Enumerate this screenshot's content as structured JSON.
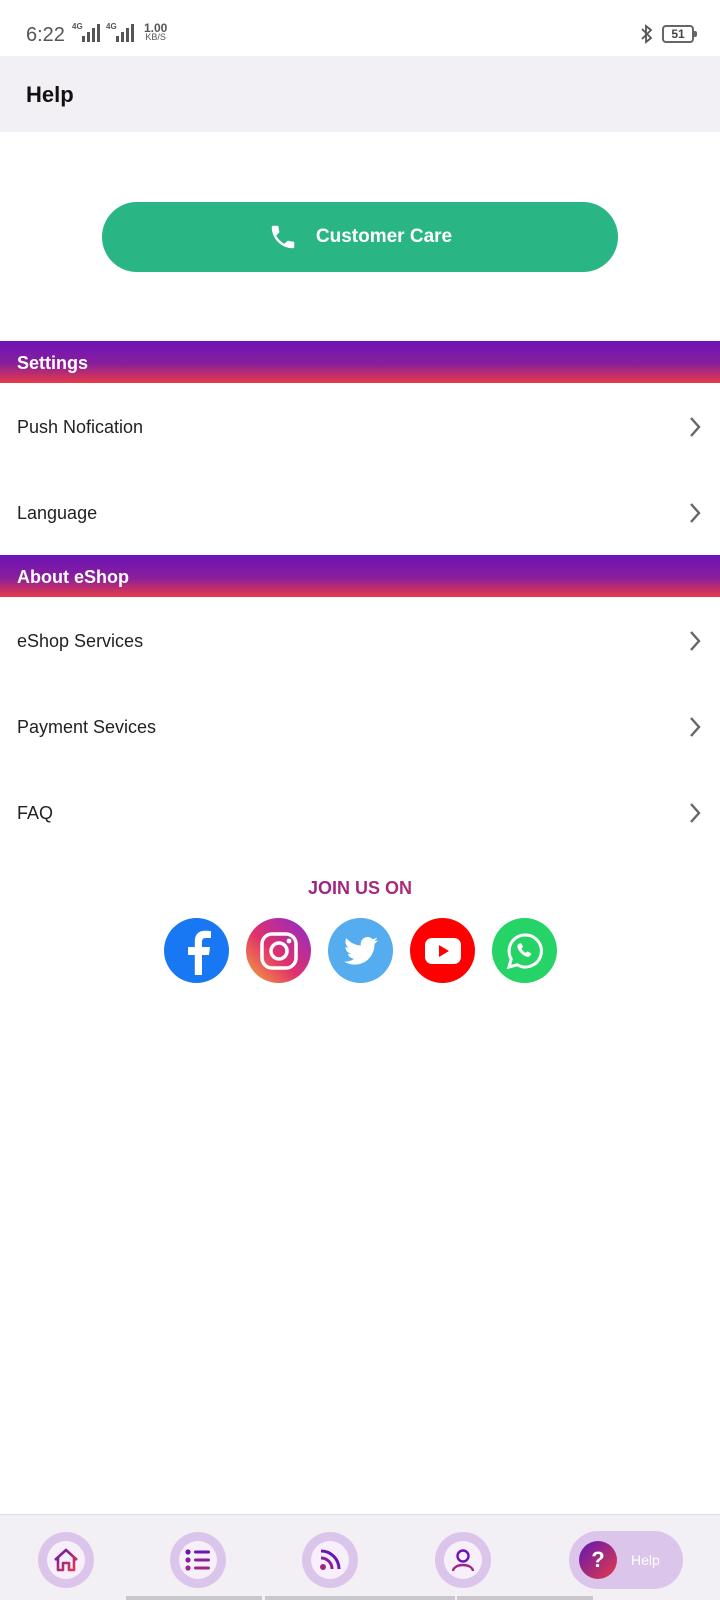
{
  "status_bar": {
    "time": "6:22",
    "signal_1": "4G",
    "signal_2": "4G",
    "net_speed_value": "1.00",
    "net_speed_unit": "KB/S",
    "battery": "51"
  },
  "header": {
    "title": "Help"
  },
  "customer_care": {
    "label": "Customer Care",
    "icon": "phone-icon"
  },
  "sections": {
    "settings": {
      "title": "Settings",
      "items": [
        {
          "label": "Push Nofication"
        },
        {
          "label": "Language"
        }
      ]
    },
    "about": {
      "title": "About eShop",
      "items": [
        {
          "label": "eShop Services"
        },
        {
          "label": "Payment Sevices"
        },
        {
          "label": "FAQ"
        }
      ]
    }
  },
  "social": {
    "heading": "JOIN US ON",
    "links": [
      "facebook",
      "instagram",
      "twitter",
      "youtube",
      "whatsapp"
    ]
  },
  "bottom_nav": {
    "items": [
      "home",
      "categories",
      "feed",
      "profile"
    ],
    "active": {
      "name": "help",
      "label": "Help"
    }
  },
  "colors": {
    "accent_green": "#29b684",
    "gradient_start": "#6b13b7",
    "gradient_end": "#e83a47",
    "nav_bubble": "#dcc5ea"
  }
}
